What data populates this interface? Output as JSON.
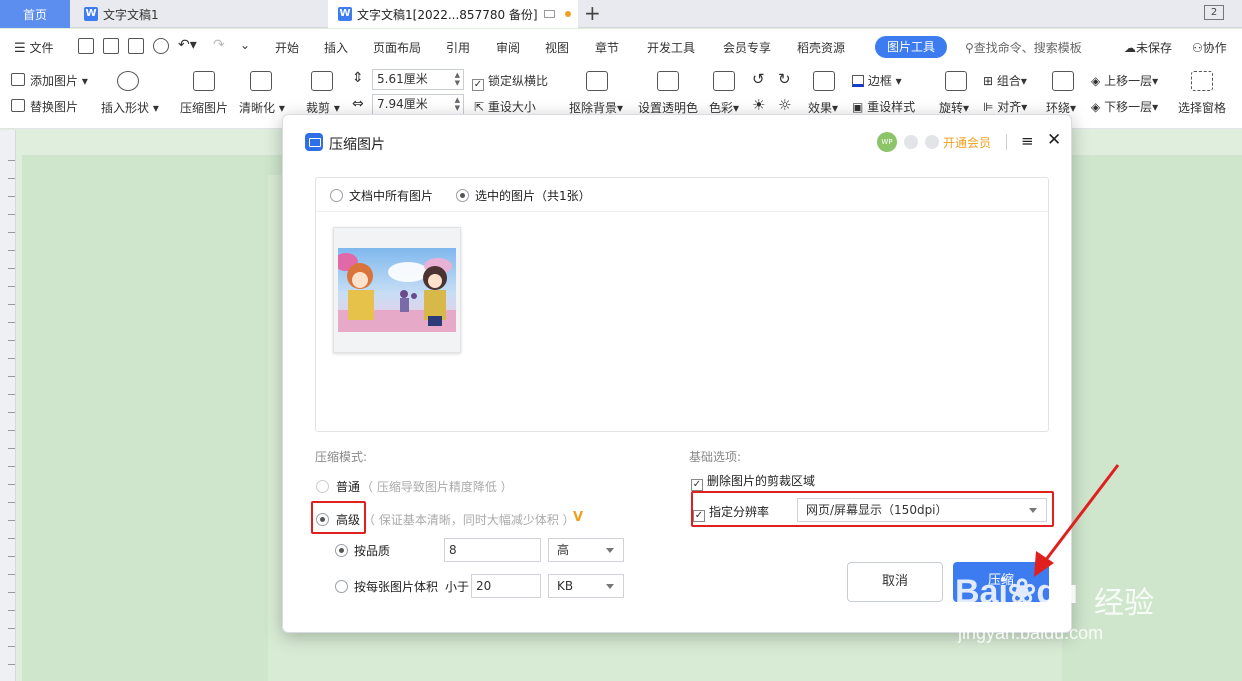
{
  "tabs": {
    "home": "首页",
    "doc1": "文字文稿1",
    "doc2": "文字文稿1[2022...857780 备份]",
    "window_count": "2"
  },
  "menu": {
    "file": "文件",
    "items": [
      "开始",
      "插入",
      "页面布局",
      "引用",
      "审阅",
      "视图",
      "章节",
      "开发工具",
      "会员专享",
      "稻壳资源"
    ],
    "active": "图片工具",
    "search": "查找命令、搜索模板",
    "unsaved": "未保存",
    "collab": "协作"
  },
  "ribbon": {
    "add_picture": "添加图片",
    "replace_picture": "替换图片",
    "insert_shape": "插入形状",
    "compress_picture": "压缩图片",
    "sharpen": "清晰化",
    "crop": "裁剪",
    "width": "5.61厘米",
    "height": "7.94厘米",
    "lock_ratio": "锁定纵横比",
    "reset_size": "重设大小",
    "remove_bg": "抠除背景",
    "set_transparent": "设置透明色",
    "color": "色彩",
    "effects": "效果",
    "border": "边框",
    "reset_style": "重设样式",
    "rotate": "旋转",
    "group": "组合",
    "align": "对齐",
    "wrap": "环绕",
    "bring_forward": "上移一层",
    "send_backward": "下移一层",
    "selection_pane": "选择窗格"
  },
  "dialog": {
    "title": "压缩图片",
    "vip_label": "开通会员",
    "scope_all": "文档中所有图片",
    "scope_selected": "选中的图片（共1张）",
    "mode_label": "压缩模式:",
    "mode_normal": "普通",
    "mode_normal_hint": "（ 压缩导致图片精度降低 ）",
    "mode_advanced": "高级",
    "mode_advanced_hint": "（ 保证基本清晰，同时大幅减少体积 ）",
    "by_quality": "按品质",
    "quality_value": "8",
    "quality_level": "高",
    "by_size": "按每张图片体积",
    "size_less_than": "小于",
    "size_value": "20",
    "size_unit": "KB",
    "basic_label": "基础选项:",
    "delete_crop": "删除图片的剪裁区域",
    "set_resolution": "指定分辨率",
    "resolution_value": "网页/屏幕显示（150dpi）",
    "cancel": "取消",
    "compress": "压缩"
  },
  "watermark": {
    "brand": "经验",
    "url": "jingyan.baidu.com"
  },
  "colors": {
    "accent": "#3d7cf0",
    "highlight_red": "#e0201f",
    "doc_bg": "#cfe6cc"
  }
}
